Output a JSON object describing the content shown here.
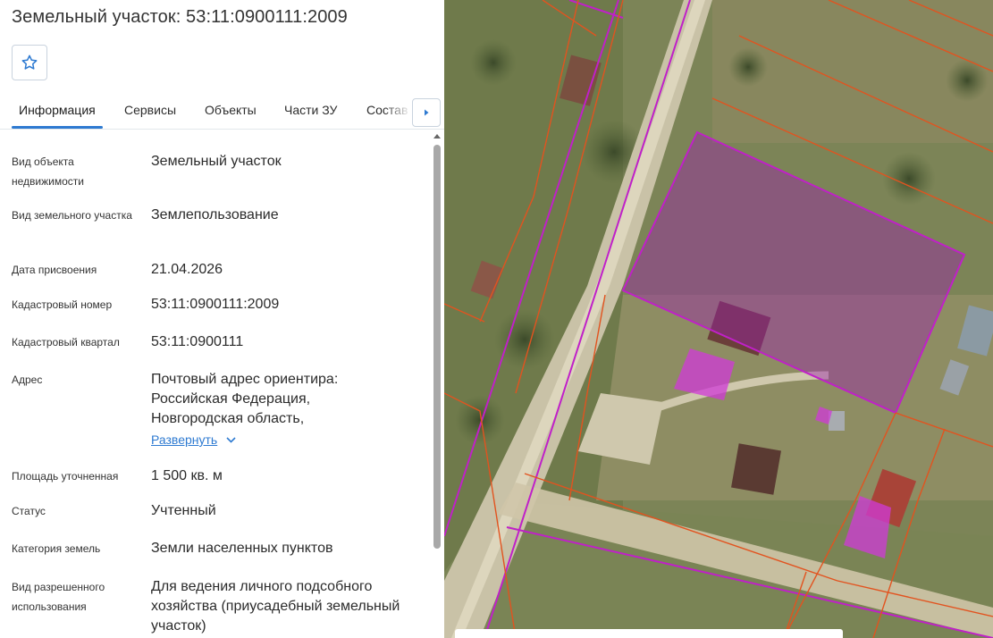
{
  "header": {
    "title": "Земельный участок: 53:11:0900111:2009"
  },
  "tabs": [
    {
      "label": "Информация"
    },
    {
      "label": "Сервисы"
    },
    {
      "label": "Объекты"
    },
    {
      "label": "Части ЗУ"
    },
    {
      "label": "Состав"
    }
  ],
  "info": {
    "object_type": {
      "label": "Вид объекта недвижимости",
      "value": "Земельный участок"
    },
    "land_type": {
      "label": "Вид земельного участка",
      "value": "Землепользование"
    },
    "assign_date": {
      "label": "Дата присвоения",
      "value": "21.04.2026"
    },
    "cadastral_number": {
      "label": "Кадастровый номер",
      "value": "53:11:0900111:2009"
    },
    "cadastral_quarter": {
      "label": "Кадастровый квартал",
      "value": "53:11:0900111"
    },
    "address": {
      "label": "Адрес",
      "line1": "Почтовый адрес ориентира:",
      "line2": "Российская Федерация,",
      "line3": "Новгородская область,",
      "expand_label": "Развернуть"
    },
    "area": {
      "label": "Площадь уточненная",
      "value": "1 500 кв. м"
    },
    "status": {
      "label": "Статус",
      "value": "Учтенный"
    },
    "land_category": {
      "label": "Категория земель",
      "value": "Земли населенных пунктов"
    },
    "permitted_use": {
      "label": "Вид разрешенного использования",
      "value": "Для ведения личного подсобного хозяйства (приусадебный земельный участок)"
    }
  },
  "colors": {
    "accent": "#2e7ad1",
    "parcel_highlight": "#b000b5",
    "parcel_border": "#e2531f"
  }
}
